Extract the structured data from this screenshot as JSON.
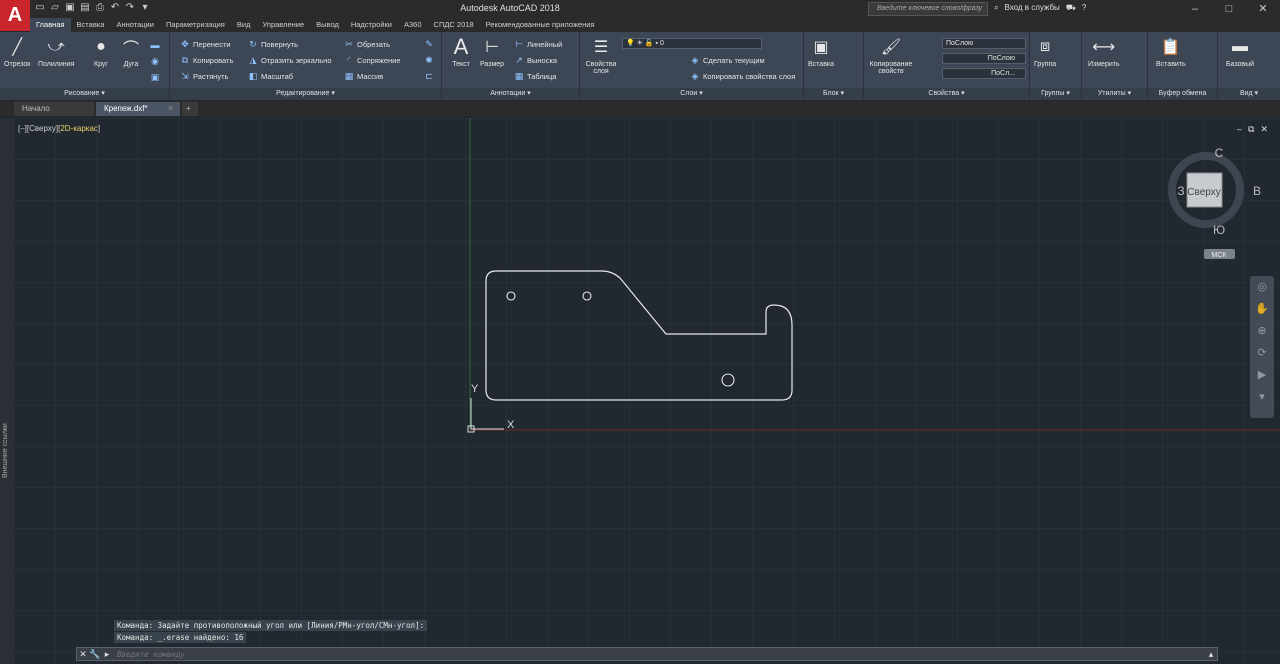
{
  "app": {
    "logo": "A",
    "title": "Autodesk AutoCAD 2018",
    "search_placeholder": "Введите ключевое слово/фразу",
    "signin": "Вход в службы"
  },
  "menu_tabs": [
    "Главная",
    "Вставка",
    "Аннотации",
    "Параметризация",
    "Вид",
    "Управление",
    "Вывод",
    "Надстройки",
    "A360",
    "СПДС 2018",
    "Рекомендованные приложения"
  ],
  "ribbon": {
    "draw": {
      "title": "Рисование ▾",
      "line": "Отрезок",
      "polyline": "Полилиния",
      "circle": "Круг",
      "arc": "Дуга"
    },
    "modify": {
      "title": "Редактирование ▾",
      "move": "Перенести",
      "rotate": "Повернуть",
      "trim": "Обрезать",
      "copy": "Копировать",
      "mirror": "Отразить зеркально",
      "fillet": "Сопряжение",
      "stretch": "Растянуть",
      "scale": "Масштаб",
      "array": "Массив"
    },
    "annotation": {
      "title": "Аннотации ▾",
      "text": "Текст",
      "dimension": "Размер",
      "linear": "Линейный",
      "leader": "Выноска",
      "table": "Таблица"
    },
    "layers": {
      "title": "Слои ▾",
      "layer_props": "Свойства слоя",
      "layer_value": "0",
      "make_current": "Сделать текущим",
      "match_layer": "Копировать свойства слоя"
    },
    "block": {
      "title": "Блок ▾",
      "insert": "Вставка"
    },
    "properties": {
      "title": "Свойства ▾",
      "match": "Копирование свойств",
      "color": "ПоСлою",
      "linetype": "ПоСлою",
      "lineweight": "ПоСл..."
    },
    "groups": {
      "title": "Группы ▾",
      "group": "Группа"
    },
    "utilities": {
      "title": "Утилиты ▾",
      "measure": "Измерить"
    },
    "clipboard": {
      "title": "Буфер обмена",
      "paste": "Вставить"
    },
    "view": {
      "title": "Вид ▾",
      "base": "Базовый"
    }
  },
  "doc_tabs": [
    "Начало",
    "Крепеж.dxf*"
  ],
  "canvas": {
    "viewport_label_prefix": "[–][Сверху][",
    "viewport_label_mode": "2D-каркас",
    "viewport_label_suffix": "]",
    "left_strip_text": "Внешние ссылки",
    "viewcube": {
      "top": "Сверху",
      "north": "С",
      "south": "Ю",
      "west": "З",
      "east": "В",
      "ucs": "МСК"
    },
    "ucs_x": "X",
    "ucs_y": "Y"
  },
  "command": {
    "history": [
      "Команда: Задайте противоположный угол или [Линия/РМн-угол/СМн-угол]:",
      "Команда: _.erase найдено: 16"
    ],
    "placeholder": "Введите команду"
  }
}
